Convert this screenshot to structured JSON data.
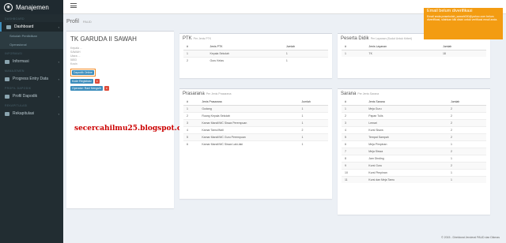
{
  "app": {
    "title": "Manajemen"
  },
  "sidebar": {
    "sections": [
      {
        "label": "DASHBOARD",
        "items": [
          {
            "label": "Dashboard",
            "active": true,
            "sub": [
              "Sekolah Penilidikan",
              "Operasional"
            ]
          }
        ]
      },
      {
        "label": "INFORMASI",
        "items": [
          {
            "label": "Informasi"
          }
        ]
      },
      {
        "label": "MANAJEMEN",
        "items": [
          {
            "label": "Progress Entry Data"
          }
        ]
      },
      {
        "label": "PROFIL DAPODIK",
        "items": [
          {
            "label": "Profil Dapodik"
          }
        ]
      },
      {
        "label": "REKAPITULASI",
        "items": [
          {
            "label": "Rekapitulasi"
          }
        ]
      }
    ]
  },
  "page": {
    "title": "Profil",
    "subtitle": "PAUD"
  },
  "school": {
    "name": "TK GARUDA II SAWAH",
    "meta": [
      "Kepala ...",
      "SAWAH",
      "Utara ...",
      "5853",
      "",
      "Kosin"
    ],
    "btn_dapodik": "Dapodik Online",
    "btn_registrasi": "Kode Registrasi",
    "btn_operator": "Operator: Rani Nengsih",
    "x_label": "x"
  },
  "watermark": "secercahilmu25.blogspot.com",
  "ptk": {
    "title": "PTK",
    "subtitle": "Per Jenis PTK",
    "headers": [
      "#",
      "Jenis PTK",
      "Jumlah"
    ],
    "rows": [
      [
        "1",
        "Kepala Sekolah",
        "1"
      ],
      [
        "2",
        "Guru Kelas",
        "1"
      ]
    ]
  },
  "peserta_didik": {
    "title": "Peserta Didik",
    "subtitle": "Per Layanan (Sudut Untuk Kriteri)",
    "headers": [
      "#",
      "Jenis Layanan",
      "Jumlah"
    ],
    "rows": [
      [
        "1",
        "TK",
        "18"
      ]
    ]
  },
  "prasarana": {
    "title": "Prasarana",
    "subtitle": "Per Jenis Prasarana",
    "headers": [
      "#",
      "Jenis Prasarana",
      "Jumlah"
    ],
    "rows": [
      [
        "1",
        "Gudang",
        "1"
      ],
      [
        "2",
        "Ruang Kepala Sekolah",
        "1"
      ],
      [
        "3",
        "Kamar Mandi/WC Siswa Perempuan",
        "1"
      ],
      [
        "4",
        "Kamar Tamu/Wali",
        "2"
      ],
      [
        "5",
        "Kamar Mandi/WC Guru Perempuan",
        "1"
      ],
      [
        "6",
        "Kamar Mandi/WC Siswa Laki-laki",
        "1"
      ]
    ]
  },
  "sarana": {
    "title": "Sarana",
    "subtitle": "Per Jenis Sarana",
    "headers": [
      "#",
      "Jenis Sarana",
      "Jumlah"
    ],
    "rows": [
      [
        "1",
        "Meja Guru",
        "2"
      ],
      [
        "2",
        "Papan Tulis",
        "2"
      ],
      [
        "3",
        "Lemari",
        "2"
      ],
      [
        "4",
        "Kursi Siswa",
        "2"
      ],
      [
        "5",
        "Tempat Sampah",
        "2"
      ],
      [
        "6",
        "Meja Pimpinan",
        "1"
      ],
      [
        "7",
        "Meja Siswa",
        "2"
      ],
      [
        "8",
        "Jam Dinding",
        "1"
      ],
      [
        "9",
        "Kursi Guru",
        "2"
      ],
      [
        "10",
        "Kursi Pimpinan",
        "1"
      ],
      [
        "11",
        "Kursi dan Meja Tamu",
        "1"
      ]
    ]
  },
  "toast": {
    "title": "Email belum diverifikasi",
    "body": "Email anda prasekolah_sawah000@yahoo.com belum diverifikasi, silahkan klik disini untuk verifikasi email anda."
  },
  "footer": "© 2015 - Direktorat Jenderal PAUD dan Dikmas"
}
